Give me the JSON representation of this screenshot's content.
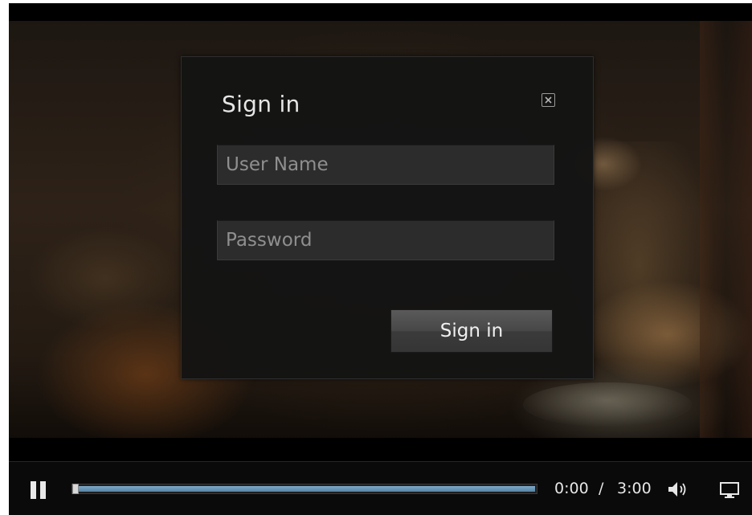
{
  "modal": {
    "title": "Sign in",
    "username_placeholder": "User Name",
    "password_placeholder": "Password",
    "submit_label": "Sign in",
    "close_icon": "close-icon"
  },
  "controls": {
    "play_state_icon": "pause-icon",
    "progress_fraction": 0.0,
    "current_time": "0:00",
    "separator": "/",
    "duration": "3:00",
    "volume_icon": "volume-icon",
    "screen_icon": "monitor-icon",
    "progress_color": "#5684a6"
  }
}
